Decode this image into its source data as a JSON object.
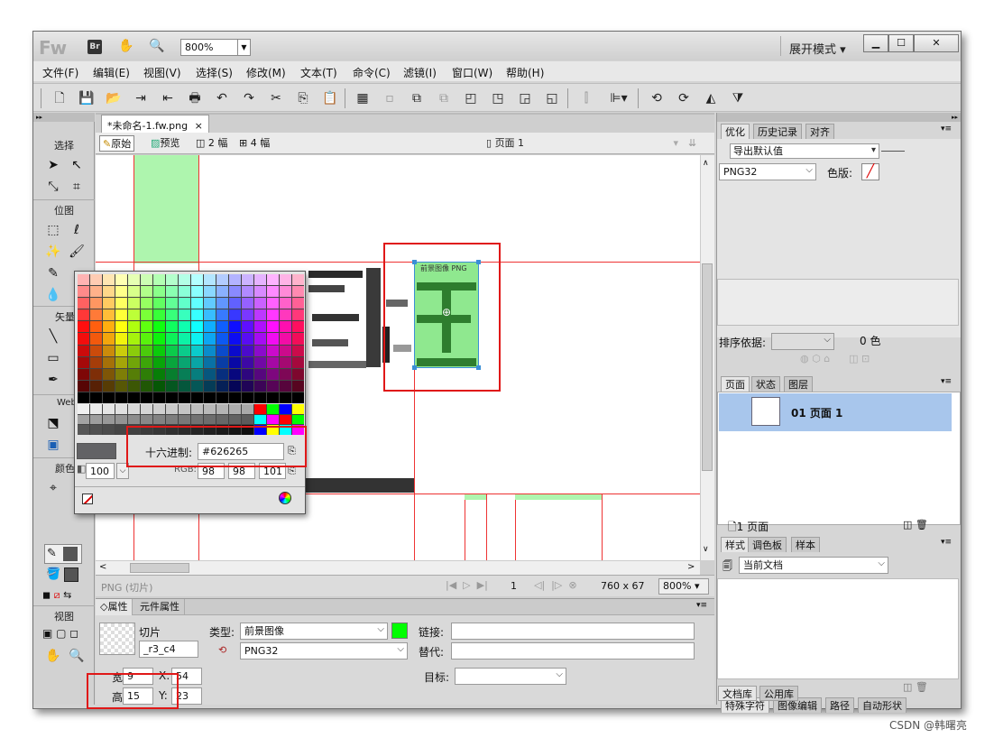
{
  "app": {
    "logo": "Fw",
    "bridge_logo": "Br",
    "zoom": "800%",
    "workspace_mode": "展开模式"
  },
  "menu": [
    "文件(F)",
    "编辑(E)",
    "视图(V)",
    "选择(S)",
    "修改(M)",
    "文本(T)",
    "命令(C)",
    "滤镜(I)",
    "窗口(W)",
    "帮助(H)"
  ],
  "tools": {
    "select": "选择",
    "bitmap": "位图",
    "vector": "矢量",
    "web": "Web",
    "colors": "颜色",
    "view": "视图"
  },
  "document": {
    "tab_title": "*未命名-1.fw.png",
    "view_original": "原始",
    "view_preview": "预览",
    "view_2up": "2 幅",
    "view_4up": "4 幅",
    "page_label": "页面 1",
    "slice_label": "前景图像 PNG"
  },
  "status": {
    "slice_info": "PNG (切片)",
    "frame": "1",
    "doc_size": "760 x 67",
    "zoom": "800%"
  },
  "palette": {
    "hex_label": "十六进制:",
    "hex_value": "#626265",
    "opacity": "100",
    "rgb_label": "RGB:",
    "r": "98",
    "g": "98",
    "b": "101",
    "current_color": "#626265"
  },
  "properties": {
    "tab_props": "属性",
    "tab_symbol": "元件属性",
    "object_type": "切片",
    "object_name": "_r3_c4",
    "type_label": "类型:",
    "type_value": "前景图像",
    "format_value": "PNG32",
    "link_label": "链接:",
    "link_value": "",
    "alt_label": "替代:",
    "alt_value": "",
    "target_label": "目标:",
    "target_value": "",
    "w_label": "宽",
    "w_value": "9",
    "h_label": "高",
    "h_value": "15",
    "x_label": "X:",
    "x_value": "54",
    "y_label": "Y:",
    "y_value": "23",
    "slice_color": "#00ff00"
  },
  "optimize": {
    "tab_optimize": "优化",
    "tab_history": "历史记录",
    "tab_align": "对齐",
    "preset": "导出默认值",
    "format": "PNG32",
    "matte_label": "色版:",
    "sort_label": "排序依据:",
    "color_count": "0 色"
  },
  "pages": {
    "tab_pages": "页面",
    "tab_states": "状态",
    "tab_layers": "图层",
    "page_item": "01 页面 1",
    "footer": "1 页面"
  },
  "styles": {
    "tab_styles": "样式",
    "tab_swatches": "调色板",
    "tab_samples": "样本",
    "source": "当前文档"
  },
  "bottom_tabs": {
    "special_chars": "特殊字符",
    "image_edit": "图像编辑",
    "path": "路径",
    "auto_shapes": "自动形状",
    "doc_lib": "文档库",
    "common_lib": "公用库"
  },
  "watermark": "CSDN @韩曙亮"
}
